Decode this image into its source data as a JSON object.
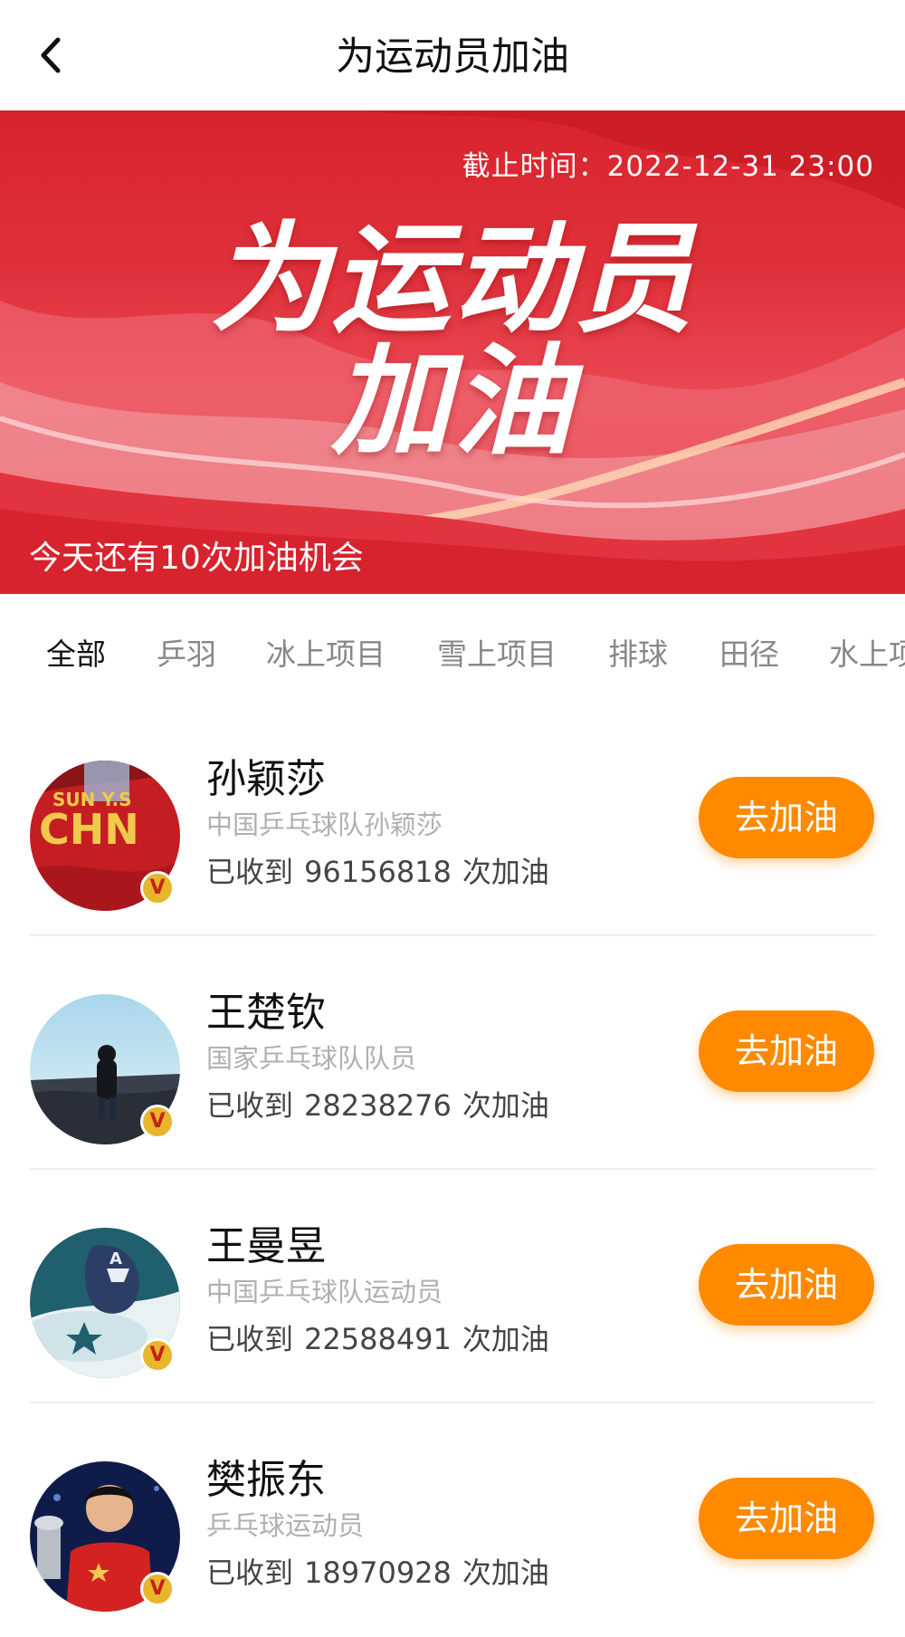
{
  "header": {
    "title": "为运动员加油"
  },
  "banner": {
    "deadline": "截止时间：2022-12-31 23:00",
    "title_line1": "为运动员",
    "title_line2": "加油",
    "chances": "今天还有10次加油机会"
  },
  "tabs": [
    "全部",
    "乒羽",
    "冰上项目",
    "雪上项目",
    "排球",
    "田径",
    "水上项目"
  ],
  "athletes": [
    {
      "name": "孙颖莎",
      "desc": "中国乒乓球队孙颖莎",
      "received_prefix": "已收到",
      "count": "96156818",
      "received_suffix": "次加油",
      "button": "去加油",
      "badge": "V"
    },
    {
      "name": "王楚钦",
      "desc": "国家乒乓球队队员",
      "received_prefix": "已收到",
      "count": "28238276",
      "received_suffix": "次加油",
      "button": "去加油",
      "badge": "V"
    },
    {
      "name": "王曼昱",
      "desc": "中国乒乓球队运动员",
      "received_prefix": "已收到",
      "count": "22588491",
      "received_suffix": "次加油",
      "button": "去加油",
      "badge": "V"
    },
    {
      "name": "樊振东",
      "desc": "乒乓球运动员",
      "received_prefix": "已收到",
      "count": "18970928",
      "received_suffix": "次加油",
      "button": "去加油",
      "badge": "V"
    }
  ],
  "colors": {
    "accent": "#ff8a00",
    "banner_red": "#e0323c",
    "badge_gold": "#e8b62a"
  }
}
